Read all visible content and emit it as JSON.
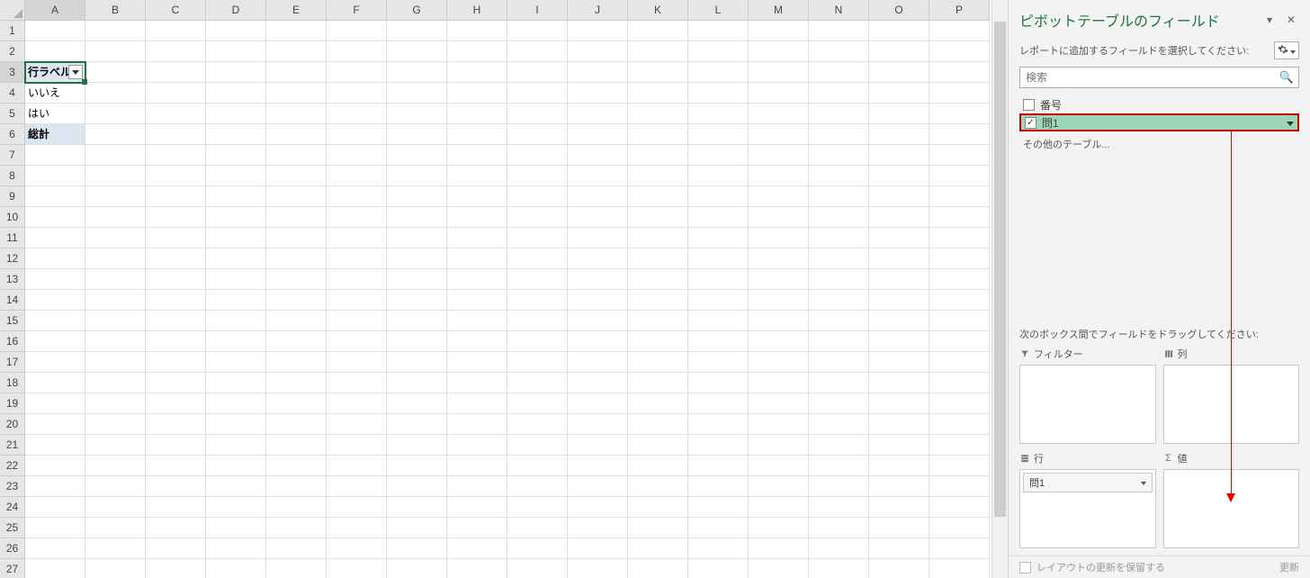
{
  "columns": [
    "A",
    "B",
    "C",
    "D",
    "E",
    "F",
    "G",
    "H",
    "I",
    "J",
    "K",
    "L",
    "M",
    "N",
    "O",
    "P"
  ],
  "rows_count": 27,
  "active_col": "A",
  "active_row": 3,
  "cells": {
    "A3": "行ラベル",
    "A4": "いいえ",
    "A5": "はい",
    "A6": "総計"
  },
  "pane": {
    "title": "ピボットテーブルのフィールド",
    "choose_text": "レポートに追加するフィールドを選択してください:",
    "search_placeholder": "検索",
    "fields": {
      "f0_label": "番号",
      "f1_label": "問1"
    },
    "more_tables": "その他のテーブル...",
    "areas_caption": "次のボックス間でフィールドをドラッグしてください:",
    "area_filter": "フィルター",
    "area_columns": "列",
    "area_rows": "行",
    "area_values": "値",
    "rows_pill": "問1",
    "defer_label": "レイアウトの更新を保留する",
    "update": "更新"
  }
}
